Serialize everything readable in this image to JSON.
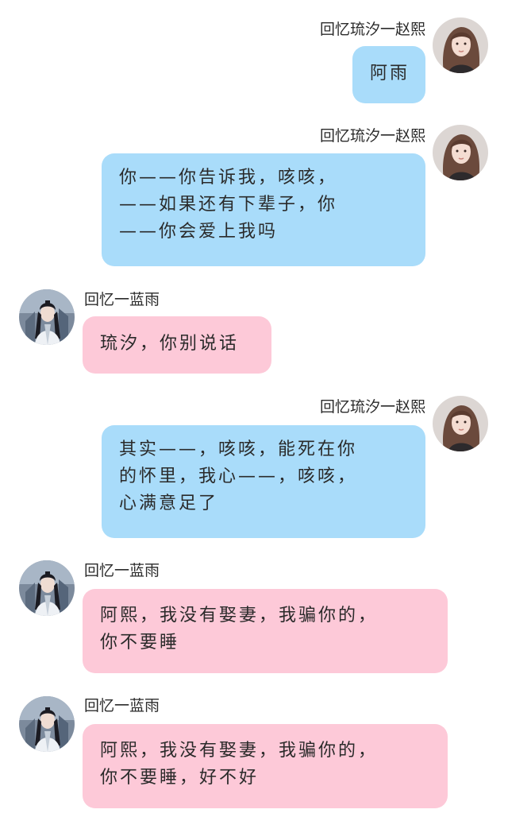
{
  "chat": {
    "sender_right": "回忆琉汐一赵熙",
    "sender_left": "回忆一蓝雨",
    "messages": [
      {
        "side": "right",
        "name": "回忆琉汐一赵熙",
        "lines": [
          "阿雨"
        ]
      },
      {
        "side": "right",
        "name": "回忆琉汐一赵熙",
        "lines": [
          "你——你告诉我，咳咳，",
          "——如果还有下辈子，你",
          "——你会爱上我吗"
        ]
      },
      {
        "side": "left",
        "name": "回忆一蓝雨",
        "lines": [
          "琉汐，你别说话"
        ]
      },
      {
        "side": "right",
        "name": "回忆琉汐一赵熙",
        "lines": [
          "其实——，咳咳，能死在你",
          "的怀里，我心——，咳咳，",
          "心满意足了"
        ]
      },
      {
        "side": "left",
        "name": "回忆一蓝雨",
        "lines": [
          "阿熙，我没有娶妻，我骗你的，",
          "你不要睡"
        ]
      },
      {
        "side": "left",
        "name": "回忆一蓝雨",
        "lines": [
          "阿熙，我没有娶妻，我骗你的，",
          "你不要睡，好不好"
        ]
      }
    ]
  },
  "colors": {
    "right_bubble": "#a9dcfa",
    "left_bubble": "#fdc9d8",
    "background": "#ffffff"
  },
  "icons": {
    "right_avatar": "woman-portrait-avatar",
    "left_avatar": "swordsman-portrait-avatar"
  }
}
